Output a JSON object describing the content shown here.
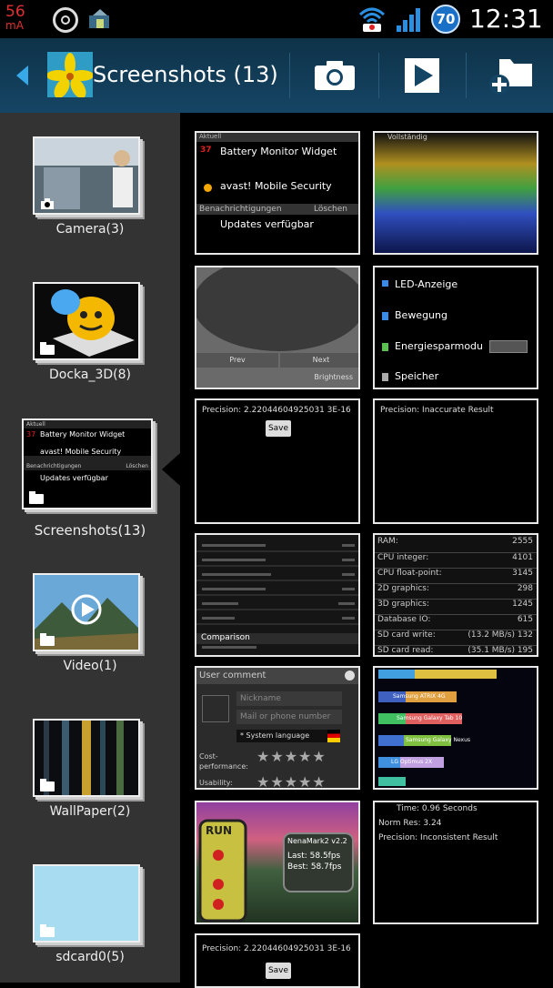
{
  "status_bar": {
    "current_value": "56",
    "current_unit": "mA",
    "battery_level": "70",
    "time": "12:31"
  },
  "action_bar": {
    "title": "Screenshots (13)",
    "back_icon": "back-arrow-icon",
    "camera_icon": "camera-icon",
    "slideshow_icon": "play-icon",
    "new_album_icon": "folder-add-icon"
  },
  "albums": [
    {
      "label": "Camera(3)"
    },
    {
      "label": "Docka_3D(8)"
    },
    {
      "label": "Screenshots(13)"
    },
    {
      "label": "Video(1)"
    },
    {
      "label": "WallPaper(2)"
    },
    {
      "label": "sdcard0(5)"
    }
  ],
  "notif_thumb": {
    "header": "Aktuell",
    "item1_title": "Battery Monitor Widget",
    "item1_badge": "37",
    "item2_title": "avast! Mobile Security",
    "section": "Benachrichtigungen",
    "clear": "Löschen",
    "item3_title": "Updates verfügbar"
  },
  "thumbs": {
    "t2_header": "Vollständig",
    "t3_prev": "Prev",
    "t3_next": "Next",
    "t3_brightness": "Brightness",
    "t4_items": [
      "LED-Anzeige",
      "Bewegung",
      "Energiesparmodu",
      "Speicher"
    ],
    "t5_text": "Precision: 2.22044604925031 3E-16",
    "t5_button": "Save",
    "t6_text": "Precision: Inaccurate Result",
    "t7_comparison": "Comparison",
    "t8_rows": [
      {
        "k": "RAM:",
        "v": "2555"
      },
      {
        "k": "CPU integer:",
        "v": "4101"
      },
      {
        "k": "CPU float-point:",
        "v": "3145"
      },
      {
        "k": "2D graphics:",
        "v": "298"
      },
      {
        "k": "3D graphics:",
        "v": "1245"
      },
      {
        "k": "Database IO:",
        "v": "615"
      },
      {
        "k": "SD card write:",
        "v": "(13.2 MB/s) 132"
      },
      {
        "k": "SD card read:",
        "v": "(35.1 MB/s) 195"
      }
    ],
    "t9_header": "User comment",
    "t9_nickname": "Nickname",
    "t9_mail": "Mail or phone number",
    "t9_language": "* System language",
    "t9_cost": "Cost-performance:",
    "t9_usability": "Usability:",
    "t11_lines": [
      "Time: 0.96  Seconds",
      "Norm Res: 3.24",
      "Precision: Inconsistent Result"
    ],
    "t10_labels": [
      "Samsung ATRIX 4G",
      "Samsung Galaxy Tab 10",
      "Samsung Galaxy Nexus",
      "LG Optimus 2X"
    ],
    "t12_title": "NenaMark2 v2.2",
    "t12_last": "Last: 58.5fps",
    "t12_best": "Best: 58.7fps",
    "t12_run": "RUN",
    "t13_text": "Precision: 2.22044604925031 3E-16",
    "t13_button": "Save"
  },
  "colors": {
    "actionbar": "#154565",
    "accent": "#37a8e8",
    "sidebar": "#333333"
  }
}
